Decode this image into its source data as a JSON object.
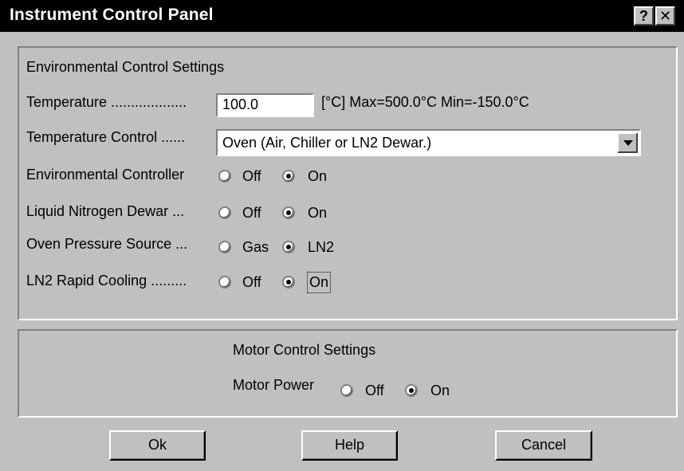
{
  "window": {
    "title": "Instrument Control Panel",
    "help_button": "?",
    "close_button": "✕"
  },
  "environmental": {
    "heading": "Environmental Control Settings",
    "temperature_label": "Temperature ...................",
    "temperature_value": "100.0",
    "temperature_range": "[°C] Max=500.0°C  Min=-150.0°C",
    "temperature_control_label": "Temperature Control ......",
    "temperature_control_value": "Oven (Air, Chiller or LN2 Dewar.)",
    "rows": [
      {
        "label": "Environmental Controller",
        "opt1": "Off",
        "opt2": "On",
        "selected": "On"
      },
      {
        "label": "Liquid Nitrogen Dewar ...",
        "opt1": "Off",
        "opt2": "On",
        "selected": "On"
      },
      {
        "label": "Oven Pressure Source ...",
        "opt1": "Gas",
        "opt2": "LN2",
        "selected": "LN2"
      },
      {
        "label": "LN2 Rapid Cooling .........",
        "opt1": "Off",
        "opt2": "On",
        "selected": "On"
      }
    ]
  },
  "motor": {
    "heading": "Motor Control Settings",
    "power_label": "Motor Power",
    "opt1": "Off",
    "opt2": "On",
    "selected": "On"
  },
  "buttons": {
    "ok": "Ok",
    "help": "Help",
    "cancel": "Cancel"
  }
}
